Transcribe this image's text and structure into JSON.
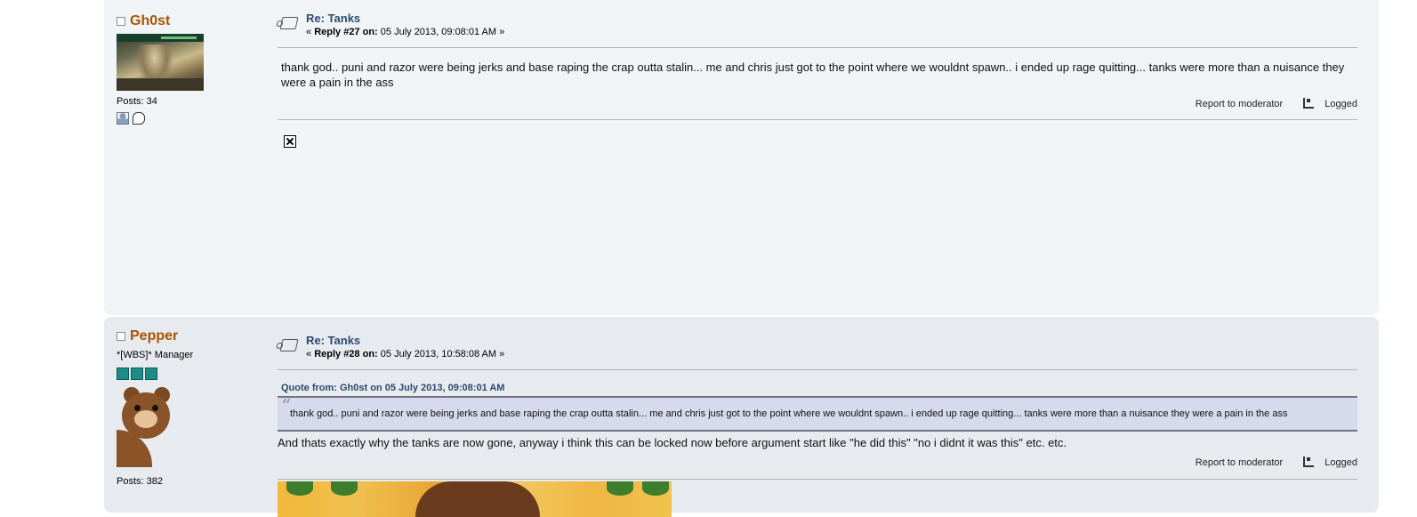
{
  "posts": [
    {
      "author": "Gh0st",
      "posts_count": "Posts: 34",
      "subject": "Re: Tanks",
      "reply_prefix": "«",
      "reply_label": "Reply #27 on:",
      "reply_date": "05 July 2013, 09:08:01 AM »",
      "body": "thank god.. puni and razor were being jerks and base raping the crap outta stalin... me and chris just got to the point where we wouldnt spawn.. i ended up rage quitting... tanks were more than a nuisance they were a pain in the ass",
      "report": "Report to moderator",
      "logged": "Logged"
    },
    {
      "author": "Pepper",
      "rank": "*[WBS]* Manager",
      "posts_count": "Posts: 382",
      "subject": "Re: Tanks",
      "reply_prefix": "«",
      "reply_label": "Reply #28 on:",
      "reply_date": "05 July 2013, 10:58:08 AM »",
      "quote_header": "Quote from: Gh0st on 05 July 2013, 09:08:01 AM",
      "quote_body": "thank god.. puni and razor were being jerks and base raping the crap outta stalin... me and chris just got to the point where we wouldnt spawn.. i ended up rage quitting... tanks were more than a nuisance they were a pain in the ass",
      "body": "And thats exactly why the tanks are now gone, anyway i think this can be locked now before argument start like \"he did this\" \"no i didnt it was this\" etc. etc.",
      "report": "Report to moderator",
      "logged": "Logged"
    }
  ],
  "icons": {
    "status": "offline-status-icon",
    "profile": "profile-icon",
    "pm": "personal-message-icon",
    "topic": "topic-icon",
    "logged": "logged-ip-icon",
    "broken_image": "broken-image-icon"
  },
  "colors": {
    "username": "#a85400",
    "subject_link": "#2b4a6d",
    "post_bg_light": "#f0f4f7",
    "post_bg_dark": "#e7eaef",
    "quote_bg": "#d7daec",
    "rank_star": "#1d8c85"
  }
}
